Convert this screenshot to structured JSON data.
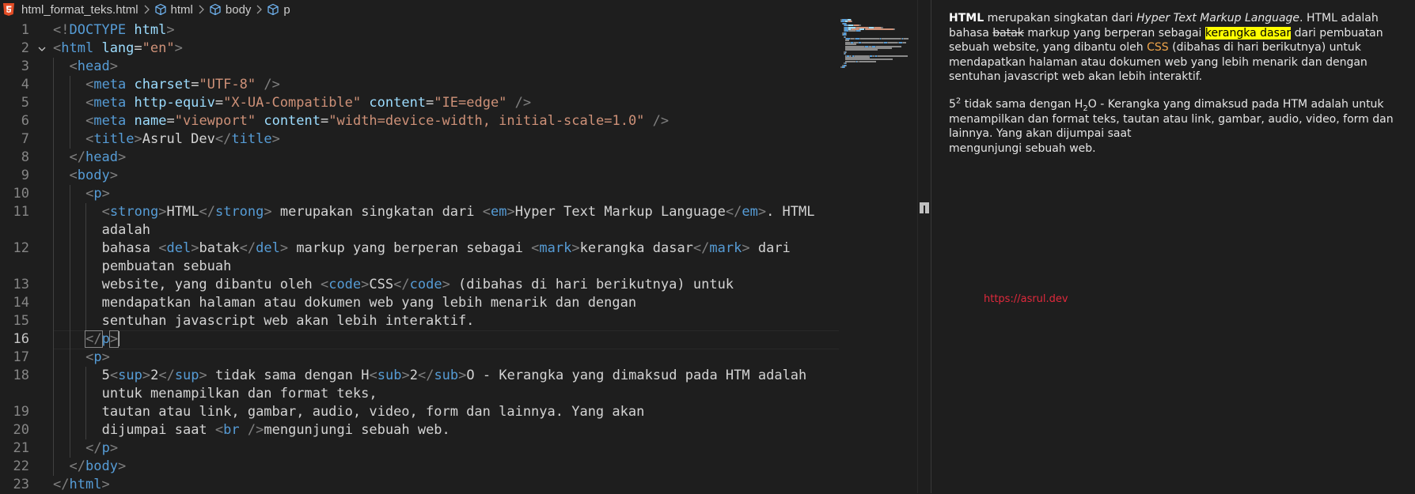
{
  "breadcrumb": {
    "file": "html_format_teks.html",
    "items": [
      "html",
      "body",
      "p"
    ]
  },
  "code": {
    "lines": [
      {
        "num": "1",
        "parts": [
          [
            "t",
            "<!"
          ],
          [
            "n",
            "DOCTYPE"
          ],
          [
            "x",
            " "
          ],
          [
            "a",
            "html"
          ],
          [
            "t",
            ">"
          ]
        ]
      },
      {
        "num": "2",
        "parts": [
          [
            "t",
            "<"
          ],
          [
            "n",
            "html"
          ],
          [
            "x",
            " "
          ],
          [
            "a",
            "lang"
          ],
          [
            "x",
            "="
          ],
          [
            "s",
            "\"en\""
          ],
          [
            "t",
            ">"
          ]
        ]
      },
      {
        "num": "3",
        "parts": [
          [
            "t",
            "<"
          ],
          [
            "n",
            "head"
          ],
          [
            "t",
            ">"
          ]
        ]
      },
      {
        "num": "4",
        "parts": [
          [
            "t",
            "<"
          ],
          [
            "n",
            "meta"
          ],
          [
            "x",
            " "
          ],
          [
            "a",
            "charset"
          ],
          [
            "x",
            "="
          ],
          [
            "s",
            "\"UTF-8\""
          ],
          [
            "x",
            " "
          ],
          [
            "t",
            "/>"
          ]
        ]
      },
      {
        "num": "5",
        "parts": [
          [
            "t",
            "<"
          ],
          [
            "n",
            "meta"
          ],
          [
            "x",
            " "
          ],
          [
            "a",
            "http-equiv"
          ],
          [
            "x",
            "="
          ],
          [
            "s",
            "\"X-UA-Compatible\""
          ],
          [
            "x",
            " "
          ],
          [
            "a",
            "content"
          ],
          [
            "x",
            "="
          ],
          [
            "s",
            "\"IE=edge\""
          ],
          [
            "x",
            " "
          ],
          [
            "t",
            "/>"
          ]
        ]
      },
      {
        "num": "6",
        "parts": [
          [
            "t",
            "<"
          ],
          [
            "n",
            "meta"
          ],
          [
            "x",
            " "
          ],
          [
            "a",
            "name"
          ],
          [
            "x",
            "="
          ],
          [
            "s",
            "\"viewport\""
          ],
          [
            "x",
            " "
          ],
          [
            "a",
            "content"
          ],
          [
            "x",
            "="
          ],
          [
            "s",
            "\"width=device-width, initial-scale=1.0\""
          ],
          [
            "x",
            " "
          ],
          [
            "t",
            "/>"
          ]
        ]
      },
      {
        "num": "7",
        "parts": [
          [
            "t",
            "<"
          ],
          [
            "n",
            "title"
          ],
          [
            "t",
            ">"
          ],
          [
            "x",
            "Asrul Dev"
          ],
          [
            "t",
            "</"
          ],
          [
            "n",
            "title"
          ],
          [
            "t",
            ">"
          ]
        ]
      },
      {
        "num": "8",
        "parts": [
          [
            "t",
            "</"
          ],
          [
            "n",
            "head"
          ],
          [
            "t",
            ">"
          ]
        ]
      },
      {
        "num": "9",
        "parts": [
          [
            "t",
            "<"
          ],
          [
            "n",
            "body"
          ],
          [
            "t",
            ">"
          ]
        ]
      },
      {
        "num": "10",
        "parts": [
          [
            "t",
            "<"
          ],
          [
            "n",
            "p"
          ],
          [
            "t",
            ">"
          ]
        ]
      },
      {
        "num": "11",
        "parts": [
          [
            "t",
            "<"
          ],
          [
            "n",
            "strong"
          ],
          [
            "t",
            ">"
          ],
          [
            "x",
            "HTML"
          ],
          [
            "t",
            "</"
          ],
          [
            "n",
            "strong"
          ],
          [
            "t",
            ">"
          ],
          [
            "x",
            " merupakan singkatan dari "
          ],
          [
            "t",
            "<"
          ],
          [
            "n",
            "em"
          ],
          [
            "t",
            ">"
          ],
          [
            "x",
            "Hyper Text Markup Language"
          ],
          [
            "t",
            "</"
          ],
          [
            "n",
            "em"
          ],
          [
            "t",
            ">"
          ],
          [
            "x",
            ". HTML"
          ]
        ]
      },
      {
        "num": "",
        "parts": [
          [
            "x",
            "adalah"
          ]
        ]
      },
      {
        "num": "12",
        "parts": [
          [
            "x",
            "bahasa "
          ],
          [
            "t",
            "<"
          ],
          [
            "n",
            "del"
          ],
          [
            "t",
            ">"
          ],
          [
            "x",
            "batak"
          ],
          [
            "t",
            "</"
          ],
          [
            "n",
            "del"
          ],
          [
            "t",
            ">"
          ],
          [
            "x",
            " markup yang berperan sebagai "
          ],
          [
            "t",
            "<"
          ],
          [
            "n",
            "mark"
          ],
          [
            "t",
            ">"
          ],
          [
            "x",
            "kerangka dasar"
          ],
          [
            "t",
            "</"
          ],
          [
            "n",
            "mark"
          ],
          [
            "t",
            ">"
          ],
          [
            "x",
            " dari"
          ]
        ]
      },
      {
        "num": "",
        "parts": [
          [
            "x",
            "pembuatan sebuah"
          ]
        ]
      },
      {
        "num": "13",
        "parts": [
          [
            "x",
            "website, yang dibantu oleh "
          ],
          [
            "t",
            "<"
          ],
          [
            "n",
            "code"
          ],
          [
            "t",
            ">"
          ],
          [
            "x",
            "CSS"
          ],
          [
            "t",
            "</"
          ],
          [
            "n",
            "code"
          ],
          [
            "t",
            ">"
          ],
          [
            "x",
            " (dibahas di hari berikutnya) untuk"
          ]
        ]
      },
      {
        "num": "14",
        "parts": [
          [
            "x",
            "mendapatkan halaman atau dokumen web yang lebih menarik dan dengan"
          ]
        ]
      },
      {
        "num": "15",
        "parts": [
          [
            "x",
            "sentuhan javascript web akan lebih interaktif."
          ]
        ]
      },
      {
        "num": "16",
        "parts": [
          [
            "t",
            "</"
          ],
          [
            "n",
            "p"
          ],
          [
            "t",
            ">"
          ]
        ]
      },
      {
        "num": "17",
        "parts": [
          [
            "t",
            "<"
          ],
          [
            "n",
            "p"
          ],
          [
            "t",
            ">"
          ]
        ]
      },
      {
        "num": "18",
        "parts": [
          [
            "x",
            "5"
          ],
          [
            "t",
            "<"
          ],
          [
            "n",
            "sup"
          ],
          [
            "t",
            ">"
          ],
          [
            "x",
            "2"
          ],
          [
            "t",
            "</"
          ],
          [
            "n",
            "sup"
          ],
          [
            "t",
            ">"
          ],
          [
            "x",
            " tidak sama dengan H"
          ],
          [
            "t",
            "<"
          ],
          [
            "n",
            "sub"
          ],
          [
            "t",
            ">"
          ],
          [
            "x",
            "2"
          ],
          [
            "t",
            "</"
          ],
          [
            "n",
            "sub"
          ],
          [
            "t",
            ">"
          ],
          [
            "x",
            "O - Kerangka yang dimaksud pada HTM adalah"
          ]
        ]
      },
      {
        "num": "",
        "parts": [
          [
            "x",
            "untuk menampilkan dan format teks,"
          ]
        ]
      },
      {
        "num": "19",
        "parts": [
          [
            "x",
            "tautan atau link, gambar, audio, video, form dan lainnya. Yang akan"
          ]
        ]
      },
      {
        "num": "20",
        "parts": [
          [
            "x",
            "dijumpai saat "
          ],
          [
            "t",
            "<"
          ],
          [
            "n",
            "br"
          ],
          [
            "x",
            " "
          ],
          [
            "t",
            "/>"
          ],
          [
            "x",
            "mengunjungi sebuah web."
          ]
        ]
      },
      {
        "num": "21",
        "parts": [
          [
            "t",
            "</"
          ],
          [
            "n",
            "p"
          ],
          [
            "t",
            ">"
          ]
        ]
      },
      {
        "num": "22",
        "parts": [
          [
            "t",
            "</"
          ],
          [
            "n",
            "body"
          ],
          [
            "t",
            ">"
          ]
        ]
      },
      {
        "num": "23",
        "parts": [
          [
            "t",
            "</"
          ],
          [
            "n",
            "html"
          ],
          [
            "t",
            ">"
          ]
        ]
      }
    ],
    "indents": [
      0,
      0,
      1,
      2,
      2,
      2,
      2,
      1,
      1,
      2,
      3,
      3,
      3,
      3,
      3,
      3,
      3,
      2,
      2,
      3,
      3,
      3,
      3,
      2,
      1,
      0
    ],
    "active_line": "16"
  },
  "preview": {
    "p1": {
      "strong": "HTML",
      "t1": " merupakan singkatan dari ",
      "em": "Hyper Text Markup Language",
      "t2": ". HTML adalah bahasa ",
      "del": "batak",
      "t3": " markup yang berperan sebagai ",
      "mark": "kerangka dasar",
      "t4": " dari pembuatan sebuah website, yang dibantu oleh ",
      "code": "CSS",
      "t5": " (dibahas di hari berikutnya) untuk mendapatkan halaman atau dokumen web yang lebih menarik dan dengan sentuhan javascript web akan lebih interaktif."
    },
    "p2": {
      "base": "5",
      "sup": "2",
      "t1": " tidak sama dengan H",
      "sub": "2",
      "t2": "O - Kerangka yang dimaksud pada HTM adalah untuk menampilkan dan format teks, tautan atau link, gambar, audio, video, form dan lainnya. Yang akan dijumpai saat",
      "t3": "mengunjungi sebuah web."
    },
    "link": "https://asrul.dev"
  },
  "colors": {
    "background": "#1e1e1e",
    "tag_name": "#569cd6",
    "attribute": "#9cdcfe",
    "string": "#ce9178",
    "bracket": "#808080",
    "mark": "#ffff00",
    "link": "#e0293c",
    "html5_icon": "#e44d26"
  }
}
